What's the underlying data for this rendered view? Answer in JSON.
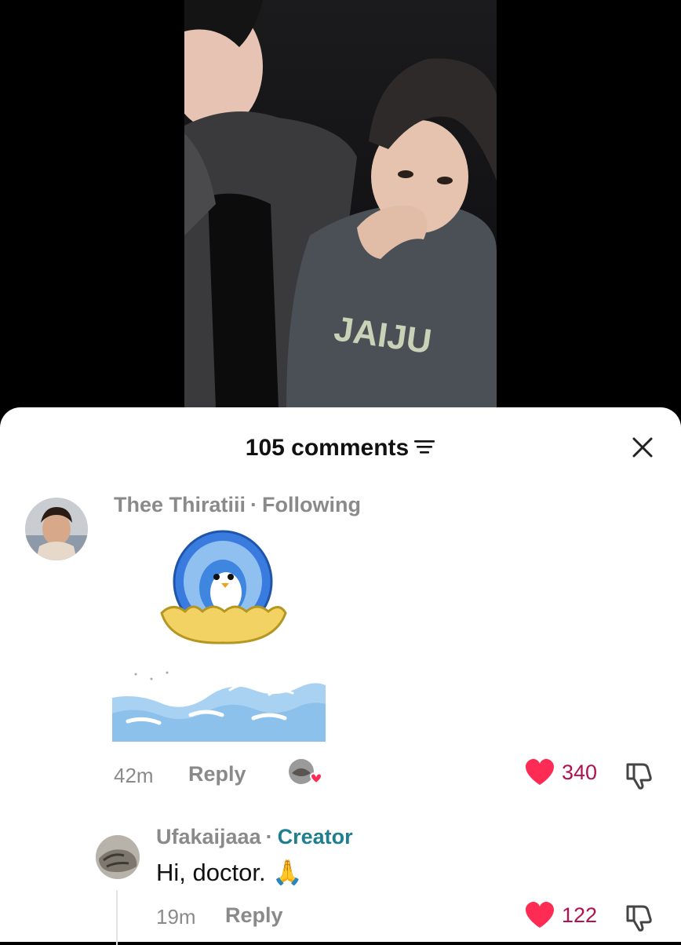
{
  "comments_panel": {
    "count_label": "105 comments",
    "colors": {
      "like_red": "#fe2c55",
      "creator_teal": "#1f7f8f"
    }
  },
  "comments": [
    {
      "author": "Thee Thiratiii",
      "relation": "Following",
      "time": "42m",
      "reply_label": "Reply",
      "likes": "340",
      "stickers": [
        "penguin-coin-in-eggshell-sticker",
        "ocean-wave-sticker"
      ]
    }
  ],
  "replies": [
    {
      "author": "Ufakaijaaa",
      "role": "Creator",
      "text": "Hi, doctor. 🙏",
      "time": "19m",
      "reply_label": "Reply",
      "likes": "122"
    }
  ]
}
